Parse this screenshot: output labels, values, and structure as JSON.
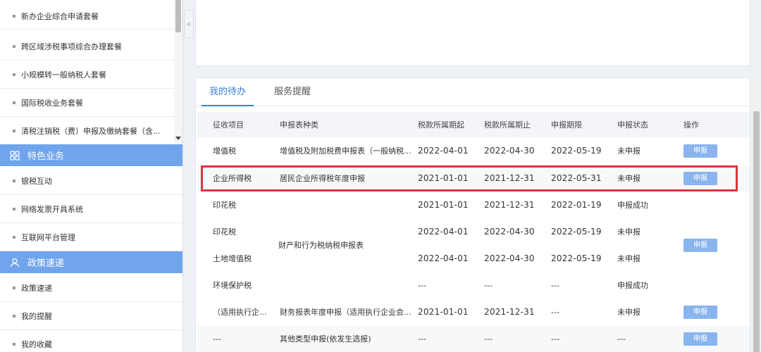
{
  "sidebar": {
    "items_top": [
      "新办企业综合申请套餐",
      "跨区域涉税事项综合办理套餐",
      "小规模转一般纳税人套餐",
      "国际税收业务套餐",
      "清税注销税（费）申报及缴纳套餐（含..."
    ],
    "header_special": "特色业务",
    "items_special": [
      "银税互动",
      "网络发票开具系统",
      "互联网平台管理"
    ],
    "header_policy": "政策速递",
    "items_policy": [
      "政策速递",
      "我的提醒",
      "我的收藏"
    ],
    "collapse_symbol": "«"
  },
  "tabs": [
    {
      "label": "我的待办",
      "active": true
    },
    {
      "label": "服务提醒",
      "active": false
    }
  ],
  "table": {
    "headers": [
      "征收项目",
      "申报表种类",
      "税款所属期起",
      "税款所属期止",
      "申报期限",
      "申报状态",
      "操作"
    ],
    "rows": [
      {
        "item": "增值税",
        "form": "增值税及附加税费申报表（一般纳税...",
        "start": "2022-04-01",
        "end": "2022-04-30",
        "deadline": "2022-05-19",
        "status": "未申报",
        "action": "申报"
      },
      {
        "item": "企业所得税",
        "form": "居民企业所得税年度申报",
        "start": "2021-01-01",
        "end": "2021-12-31",
        "deadline": "2022-05-31",
        "status": "未申报",
        "action": "申报"
      },
      {
        "item": "印花税",
        "form": "",
        "start": "2021-01-01",
        "end": "2021-12-31",
        "deadline": "2022-01-19",
        "status": "申报成功",
        "action": ""
      },
      {
        "item": "印花税",
        "form": "",
        "start": "2022-04-01",
        "end": "2022-04-30",
        "deadline": "2022-05-19",
        "status": "未申报",
        "action": ""
      },
      {
        "item": "土地增值税",
        "form": "",
        "start": "2022-04-01",
        "end": "2022-04-30",
        "deadline": "2022-05-19",
        "status": "未申报",
        "action": ""
      },
      {
        "item": "环境保护税",
        "form": "",
        "start": "---",
        "end": "---",
        "deadline": "---",
        "status": "申报成功",
        "action": ""
      },
      {
        "item": "（适用执行企...",
        "form": "财务报表年度申报（适用执行企业会...",
        "start": "2021-01-01",
        "end": "2021-12-31",
        "deadline": "---",
        "status": "未申报",
        "action": "申报"
      },
      {
        "item": "---",
        "form": "其他类型申报(依发生选报)",
        "start": "---",
        "end": "---",
        "deadline": "---",
        "status": "---",
        "action": "申报"
      }
    ],
    "merged_form": "财产和行为税纳税申报表",
    "merged_action": "申报"
  },
  "colors": {
    "accent": "#3a82d5",
    "sidebar_header": "#70a5ec",
    "button": "#8ab4ee",
    "highlight_border": "#d9363e"
  }
}
